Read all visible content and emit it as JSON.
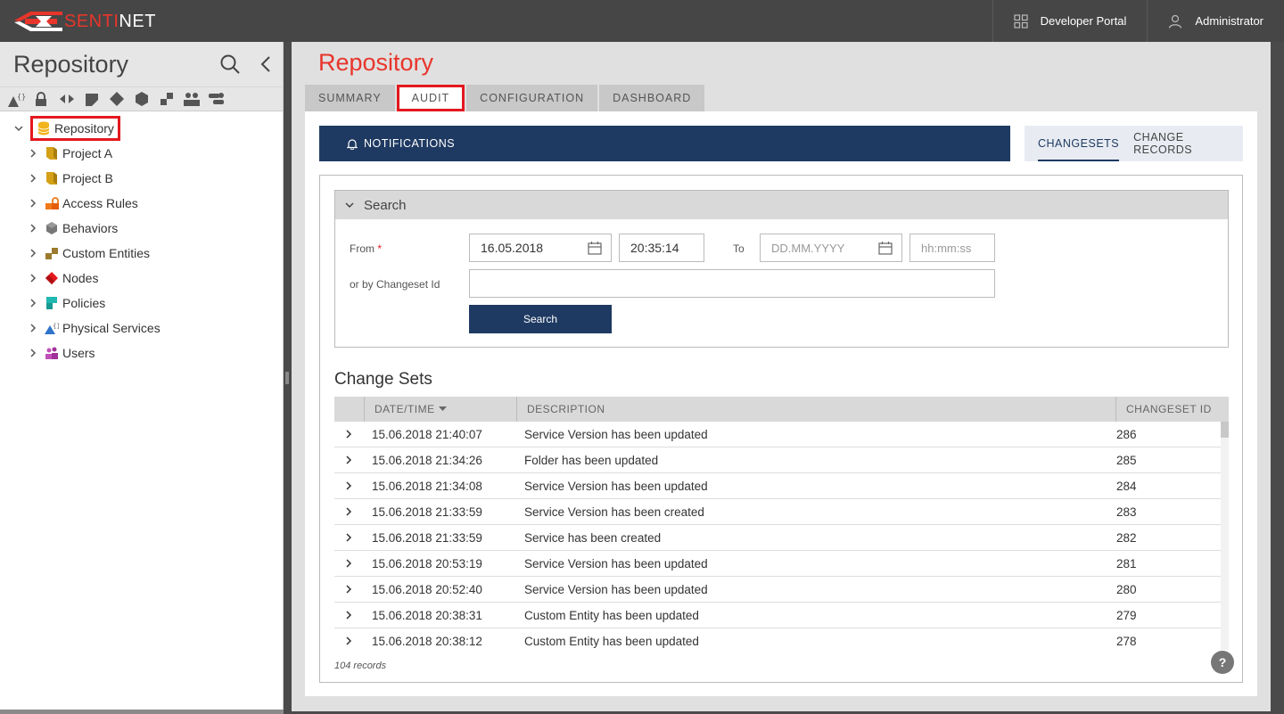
{
  "topbar": {
    "logo_prefix": "SENTI",
    "logo_suffix": "NET",
    "developer_portal": "Developer Portal",
    "user": "Administrator"
  },
  "sidebar": {
    "title": "Repository",
    "toolbar_icons": [
      "api-icon",
      "lock-icon",
      "services-icon",
      "folder-icon",
      "node-icon",
      "behavior-icon",
      "custom-entity-icon",
      "users-icon",
      "policy-icon"
    ],
    "root": "Repository",
    "items": [
      {
        "label": "Project A",
        "icon": "project-icon",
        "color": "#d4a017"
      },
      {
        "label": "Project B",
        "icon": "project-icon",
        "color": "#d4a017"
      },
      {
        "label": "Access Rules",
        "icon": "access-rules-icon",
        "color": "#f07a1a"
      },
      {
        "label": "Behaviors",
        "icon": "behaviors-icon",
        "color": "#777777"
      },
      {
        "label": "Custom Entities",
        "icon": "custom-entities-icon",
        "color": "#9b7a2e"
      },
      {
        "label": "Nodes",
        "icon": "nodes-icon",
        "color": "#e3181e"
      },
      {
        "label": "Policies",
        "icon": "policies-icon",
        "color": "#20b8b0"
      },
      {
        "label": "Physical Services",
        "icon": "physical-services-icon",
        "color": "#2e74c8"
      },
      {
        "label": "Users",
        "icon": "users-icon",
        "color": "#a0309a"
      }
    ]
  },
  "main": {
    "title": "Repository",
    "tabs": [
      "SUMMARY",
      "AUDIT",
      "CONFIGURATION",
      "DASHBOARD"
    ],
    "active_tab": "AUDIT",
    "notifications": "NOTIFICATIONS",
    "subtabs": [
      "CHANGESETS",
      "CHANGE RECORDS"
    ],
    "search": {
      "header": "Search",
      "from_label": "From",
      "required_mark": "*",
      "from_date": "16.05.2018",
      "from_time": "20:35:14",
      "to_label": "To",
      "to_date_placeholder": "DD.MM.YYYY",
      "to_time_placeholder": "hh:mm:ss",
      "changeset_label": "or by Changeset Id",
      "button": "Search"
    },
    "changesets": {
      "title": "Change Sets",
      "columns": [
        "DATE/TIME",
        "DESCRIPTION",
        "CHANGESET ID"
      ],
      "rows": [
        {
          "datetime": "15.06.2018 21:40:07",
          "description": "Service Version has been updated",
          "id": "286"
        },
        {
          "datetime": "15.06.2018 21:34:26",
          "description": "Folder has been updated",
          "id": "285"
        },
        {
          "datetime": "15.06.2018 21:34:08",
          "description": "Service Version has been updated",
          "id": "284"
        },
        {
          "datetime": "15.06.2018 21:33:59",
          "description": "Service Version has been created",
          "id": "283"
        },
        {
          "datetime": "15.06.2018 21:33:59",
          "description": "Service has been created",
          "id": "282"
        },
        {
          "datetime": "15.06.2018 20:53:19",
          "description": "Service Version has been updated",
          "id": "281"
        },
        {
          "datetime": "15.06.2018 20:52:40",
          "description": "Service Version has been updated",
          "id": "280"
        },
        {
          "datetime": "15.06.2018 20:38:31",
          "description": "Custom Entity has been updated",
          "id": "279"
        },
        {
          "datetime": "15.06.2018 20:38:12",
          "description": "Custom Entity has been updated",
          "id": "278"
        }
      ],
      "records": "104 records"
    },
    "help": "?"
  },
  "colors": {
    "accent_red": "#e8352b",
    "navy": "#1f3a62",
    "topbar": "#464646"
  }
}
